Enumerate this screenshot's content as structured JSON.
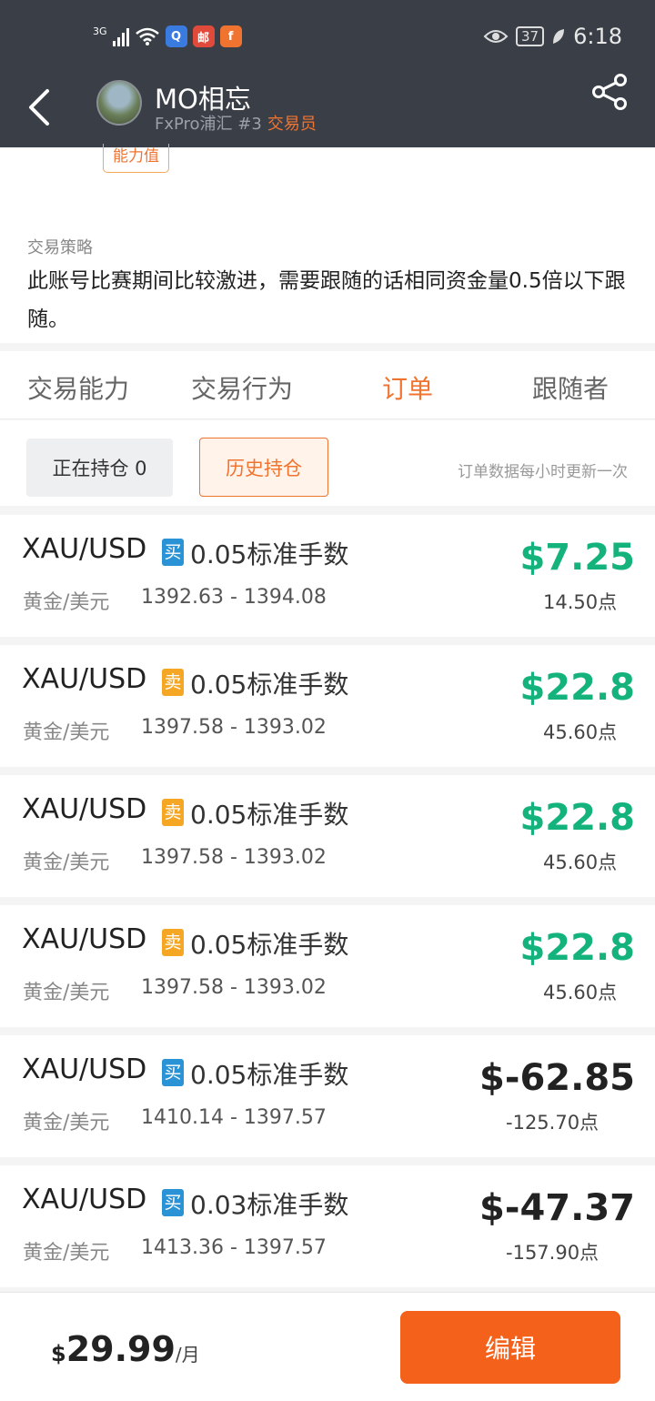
{
  "status_bar": {
    "network": "3G",
    "battery": "37",
    "time": "6:18",
    "app_icons": [
      "Q",
      "邮",
      "f"
    ]
  },
  "header": {
    "title": "MO相忘",
    "subtitle": "FxPro浦汇 #3",
    "role": "交易员"
  },
  "profile": {
    "ability_tag": "能力值"
  },
  "strategy": {
    "label": "交易策略",
    "text": "此账号比赛期间比较激进，需要跟随的话相同资金量0.5倍以下跟随。"
  },
  "tabs": [
    {
      "label": "交易能力"
    },
    {
      "label": "交易行为"
    },
    {
      "label": "订单",
      "active": true
    },
    {
      "label": "跟随者"
    }
  ],
  "filters": {
    "open_positions": "正在持仓 0",
    "history": "历史持仓",
    "note": "订单数据每小时更新一次"
  },
  "orders": [
    {
      "symbol": "XAU/USD",
      "side": "买",
      "lots": "0.05标准手数",
      "name": "黄金/美元",
      "range": "1392.63 - 1394.08",
      "pnl": "$7.25",
      "pips": "14.50点"
    },
    {
      "symbol": "XAU/USD",
      "side": "卖",
      "lots": "0.05标准手数",
      "name": "黄金/美元",
      "range": "1397.58 - 1393.02",
      "pnl": "$22.8",
      "pips": "45.60点"
    },
    {
      "symbol": "XAU/USD",
      "side": "卖",
      "lots": "0.05标准手数",
      "name": "黄金/美元",
      "range": "1397.58 - 1393.02",
      "pnl": "$22.8",
      "pips": "45.60点"
    },
    {
      "symbol": "XAU/USD",
      "side": "卖",
      "lots": "0.05标准手数",
      "name": "黄金/美元",
      "range": "1397.58 - 1393.02",
      "pnl": "$22.8",
      "pips": "45.60点"
    },
    {
      "symbol": "XAU/USD",
      "side": "买",
      "lots": "0.05标准手数",
      "name": "黄金/美元",
      "range": "1410.14 - 1397.57",
      "pnl": "$-62.85",
      "pips": "-125.70点"
    },
    {
      "symbol": "XAU/USD",
      "side": "买",
      "lots": "0.03标准手数",
      "name": "黄金/美元",
      "range": "1413.36 - 1397.57",
      "pnl": "$-47.37",
      "pips": "-157.90点"
    }
  ],
  "footer": {
    "currency": "$",
    "amount": "29.99",
    "unit": "/月",
    "edit_label": "编辑"
  },
  "colors": {
    "accent": "#f07330",
    "profit": "#14b37c",
    "header_bg": "#3a3f47",
    "buy": "#2a93d5",
    "sell": "#f5a623"
  }
}
